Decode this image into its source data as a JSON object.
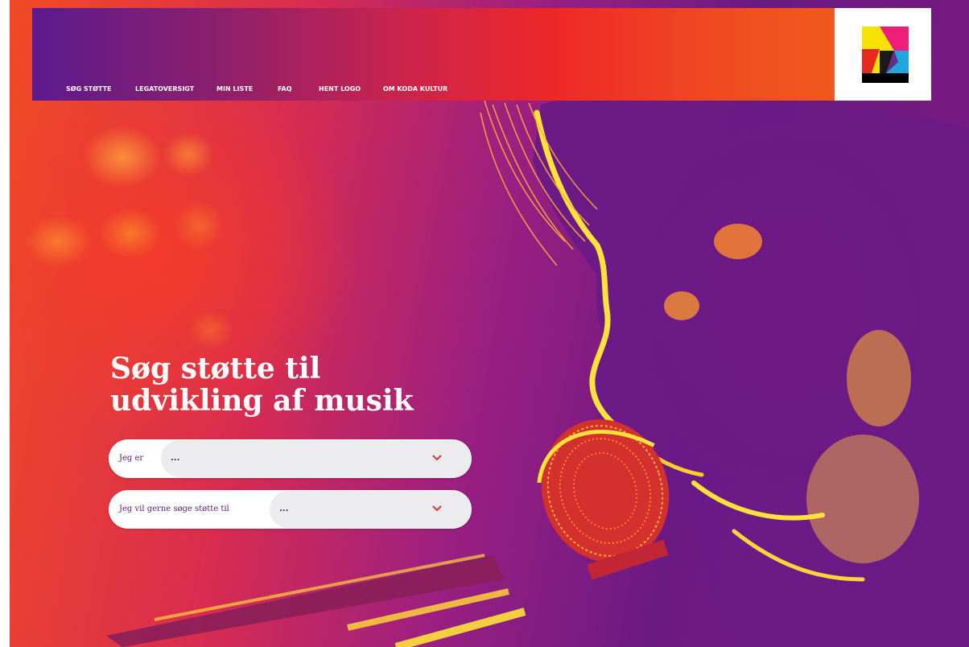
{
  "nav": {
    "items": [
      {
        "label": "SØG STØTTE"
      },
      {
        "label": "LEGATOVERSIGT"
      },
      {
        "label": "MIN LISTE"
      },
      {
        "label": "FAQ"
      },
      {
        "label": "HENT LOGO"
      },
      {
        "label": "OM KODA KULTUR"
      }
    ]
  },
  "hero": {
    "headline_line1": "Søg støtte til",
    "headline_line2": "udvikling af musik"
  },
  "form": {
    "role_label": "Jeg er",
    "role_value": "...",
    "support_label": "Jeg vil gerne søge støtte til",
    "support_value": "..."
  },
  "colors": {
    "navbar_start": "#5c1a8e",
    "navbar_end": "#f15a1c",
    "text_purple": "#5a1a6e",
    "chevron_red": "#e0304a",
    "logo_yellow": "#f7e200",
    "logo_magenta": "#ee1f7a",
    "logo_cyan": "#1fa8e0"
  },
  "icons": {
    "logo": "koda-kultur-logo",
    "dropdown": "chevron-down-icon"
  }
}
